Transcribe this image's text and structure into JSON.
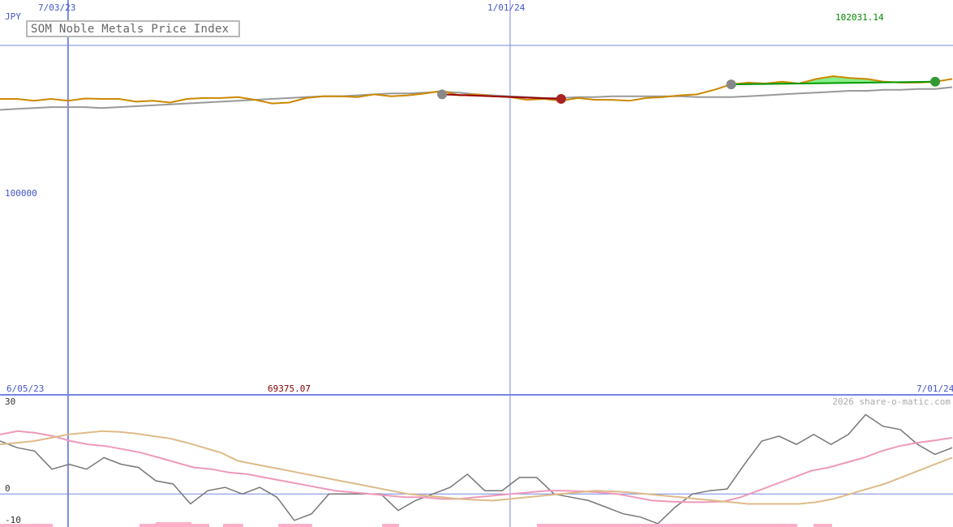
{
  "chart_data": [
    {
      "type": "line",
      "title": "SOM Noble Metals Price Index",
      "currency": "JPY",
      "xlabel": "",
      "ylabel": "JPY",
      "x_tick_labels_top": [
        "7/03/23",
        "1/01/24"
      ],
      "x_range_labels": {
        "start": "6/05/23",
        "end": "7/01/24"
      },
      "y_tick_labels": [
        "100000"
      ],
      "ylim": [
        61500,
        105000
      ],
      "annotations": {
        "max_label": "102031.14",
        "min_label": "69375.07"
      },
      "grid": true,
      "colors": {
        "price": "#cc8800",
        "average": "#999999",
        "gain_fill": "#88ee88",
        "gain_line": "#009900",
        "loss_line": "#990000",
        "axis": "#7788dd",
        "max_label": "#008800",
        "min_label": "#880000"
      },
      "x": [
        "6/05/23",
        "6/12/23",
        "6/19/23",
        "6/26/23",
        "7/03/23",
        "7/10/23",
        "7/17/23",
        "7/24/23",
        "7/31/23",
        "8/07/23",
        "8/14/23",
        "8/21/23",
        "8/28/23",
        "9/04/23",
        "9/11/23",
        "9/18/23",
        "9/25/23",
        "10/02/23",
        "10/09/23",
        "10/16/23",
        "10/23/23",
        "10/30/23",
        "11/06/23",
        "11/13/23",
        "11/20/23",
        "11/27/23",
        "12/04/23",
        "12/11/23",
        "12/18/23",
        "12/25/23",
        "1/01/24",
        "1/08/24",
        "1/15/24",
        "1/22/24",
        "1/29/24",
        "2/05/24",
        "2/12/24",
        "2/19/24",
        "2/26/24",
        "3/04/24",
        "3/11/24",
        "3/18/24",
        "3/25/24",
        "4/01/24",
        "4/08/24",
        "4/15/24",
        "4/22/24",
        "4/29/24",
        "5/06/24",
        "5/13/24",
        "5/20/24",
        "5/27/24",
        "6/03/24",
        "6/10/24",
        "6/17/24",
        "6/24/24",
        "7/01/24"
      ],
      "series": [
        {
          "name": "",
          "role": "price",
          "values": [
            94100,
            94100,
            93900,
            94100,
            93900,
            94150,
            94100,
            94100,
            93800,
            93900,
            93700,
            94100,
            94200,
            94200,
            94300,
            94000,
            93600,
            93700,
            94200,
            94400,
            94400,
            94300,
            94600,
            94400,
            94500,
            94700,
            95000,
            94500,
            94600,
            94400,
            94300,
            94000,
            94100,
            93900,
            94200,
            94000,
            94000,
            93900,
            94200,
            94300,
            94500,
            94600,
            95100,
            95700,
            95900,
            95800,
            96000,
            95800,
            96300,
            96600,
            96400,
            96300,
            96000,
            95900,
            95900,
            96000,
            96300
          ]
        },
        {
          "name": "",
          "role": "average",
          "values": [
            92900,
            93000,
            93100,
            93200,
            93200,
            93200,
            93100,
            93200,
            93300,
            93400,
            93500,
            93600,
            93700,
            93800,
            93900,
            94000,
            94100,
            94200,
            94300,
            94400,
            94400,
            94500,
            94600,
            94700,
            94700,
            94800,
            94900,
            94800,
            94600,
            94500,
            94400,
            94300,
            94200,
            94200,
            94300,
            94300,
            94400,
            94400,
            94400,
            94400,
            94400,
            94300,
            94300,
            94300,
            94400,
            94500,
            94600,
            94700,
            94800,
            94900,
            95000,
            95000,
            95100,
            95100,
            95200,
            95200,
            95400
          ]
        }
      ],
      "trend_markers": [
        {
          "type": "loss",
          "from_x": "12/04/23",
          "from_y": 94600,
          "to_x": "1/22/24",
          "to_y": 94100
        },
        {
          "type": "gain",
          "from_x": "4/01/24",
          "from_y": 95700,
          "to_x": "6/24/24",
          "to_y": 96000
        }
      ]
    },
    {
      "type": "line",
      "title": "",
      "xlabel": "",
      "ylabel": "",
      "y_tick_labels": [
        "30",
        "0",
        "-10"
      ],
      "ylim": [
        -10,
        30
      ],
      "grid": true,
      "credit": "2026 share-o-matic.com",
      "colors": {
        "momentum": "#777777",
        "fast": "#ee99bb",
        "slow": "#ddbb88",
        "volume_bars": "#ffb0c8"
      },
      "series": [
        {
          "name": "",
          "role": "momentum",
          "values": [
            16,
            14,
            13,
            7.5,
            9,
            7.5,
            11,
            9,
            8,
            4,
            3,
            -3,
            1,
            2,
            0,
            2,
            -1,
            -8,
            -6,
            0,
            0,
            0,
            0,
            -5,
            -2,
            0,
            2,
            6,
            1,
            1,
            5,
            5,
            0,
            -1,
            -2,
            -4,
            -6,
            -7,
            -9,
            -4,
            0,
            1,
            1.5,
            9,
            16,
            17.5,
            15,
            18,
            15,
            18,
            24,
            20.5,
            19.5,
            15,
            12,
            14
          ]
        },
        {
          "name": "",
          "role": "fast",
          "values": [
            18,
            19,
            18.5,
            17.5,
            16,
            15,
            14.5,
            13.5,
            12.5,
            11,
            9.5,
            8,
            7.5,
            6.5,
            6,
            5,
            4,
            3,
            2,
            1,
            0.5,
            0,
            -0.5,
            -1,
            -1,
            -1.5,
            -1.5,
            -1,
            -0.5,
            0,
            0.5,
            1,
            1,
            0.8,
            0.5,
            0,
            -1,
            -2,
            -2.3,
            -2.5,
            -2.5,
            -2.3,
            -1,
            1,
            3,
            5,
            7,
            8,
            9.5,
            11,
            13,
            14.5,
            15.5,
            16.2,
            17
          ]
        },
        {
          "name": "",
          "role": "slow",
          "values": [
            15,
            15.5,
            16,
            17,
            18,
            18.5,
            19,
            18.8,
            18.3,
            17.5,
            16.8,
            15.5,
            14,
            12.5,
            10,
            9,
            8,
            7,
            6,
            5,
            4,
            3,
            2,
            1,
            0,
            -0.5,
            -1,
            -1.5,
            -1.8,
            -2,
            -1.5,
            -1,
            -0.5,
            0,
            0.5,
            1,
            0.8,
            0.5,
            0,
            -0.5,
            -1,
            -1.5,
            -2,
            -2.5,
            -3,
            -3,
            -3,
            -3,
            -2.5,
            -1.5,
            0,
            1.5,
            3,
            5,
            7,
            9,
            11
          ]
        }
      ]
    }
  ]
}
